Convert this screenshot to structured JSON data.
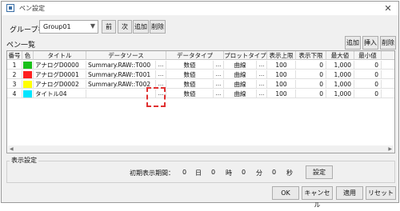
{
  "window": {
    "title": "ペン設定"
  },
  "toolbar": {
    "group_label": "グループ名",
    "group_value": "Group01",
    "prev": "前",
    "next": "次",
    "add": "追加",
    "delete": "削除"
  },
  "pen_list": {
    "label": "ペン一覧",
    "add": "追加",
    "insert": "挿入",
    "delete": "削除"
  },
  "table": {
    "headers": [
      "番号",
      "色",
      "タイトル",
      "データソース",
      "データタイプ",
      "プロットタイプ",
      "表示上限",
      "表示下限",
      "最大値",
      "最小値"
    ],
    "rows": [
      {
        "no": "1",
        "color": "#19c019",
        "title": "アナログD0000",
        "source": "Summary.RAW::T000",
        "dtype": "数値",
        "ptype": "曲線",
        "upper": "100",
        "lower": "0",
        "max": "1,000",
        "min": "0"
      },
      {
        "no": "2",
        "color": "#ff2020",
        "title": "アナログD0001",
        "source": "Summary.RAW::T001",
        "dtype": "数値",
        "ptype": "曲線",
        "upper": "100",
        "lower": "0",
        "max": "1,000",
        "min": "0"
      },
      {
        "no": "3",
        "color": "#ffff00",
        "title": "アナログD0002",
        "source": "Summary.RAW::T002",
        "dtype": "数値",
        "ptype": "曲線",
        "upper": "100",
        "lower": "0",
        "max": "1,000",
        "min": "0"
      },
      {
        "no": "4",
        "color": "#00e5ff",
        "title": "タイトル04",
        "source": "",
        "dtype": "数値",
        "ptype": "曲線",
        "upper": "100",
        "lower": "0",
        "max": "1,000",
        "min": "0"
      }
    ],
    "ellipsis": "..."
  },
  "display": {
    "group_label": "表示設定",
    "period_label": "初期表示期間：",
    "days": "0",
    "days_unit": "日",
    "hours": "0",
    "hours_unit": "時",
    "minutes": "0",
    "minutes_unit": "分",
    "seconds": "0",
    "seconds_unit": "秒",
    "set": "設定"
  },
  "footer": {
    "ok": "OK",
    "cancel": "キャンセル",
    "apply": "適用",
    "reset": "リセット"
  }
}
